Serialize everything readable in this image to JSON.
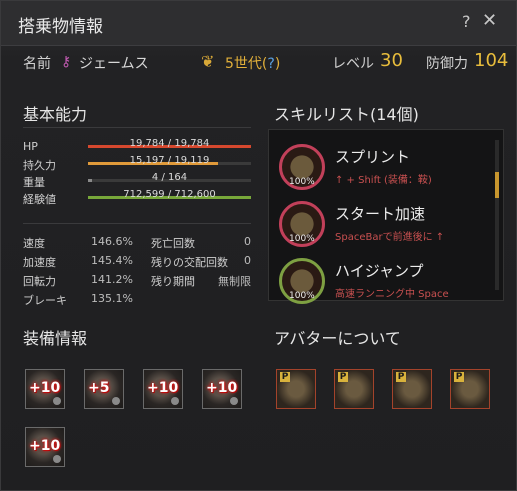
{
  "window": {
    "title": "搭乗物情報",
    "help": "?",
    "close": "✕"
  },
  "info": {
    "name_label": "名前",
    "name_value": "ジェームス",
    "generation": "5世代",
    "generation_q_open": "(",
    "generation_q": "?",
    "generation_q_close": ")",
    "level_label": "レベル",
    "level_value": "30",
    "defense_label": "防御力",
    "defense_value": "104"
  },
  "basic": {
    "title": "基本能力",
    "bars": [
      {
        "label": "HP",
        "text": "19,784 / 19,784",
        "fill": 1.0,
        "color": "#d6482e"
      },
      {
        "label": "持久力",
        "text": "15,197 / 19,119",
        "fill": 0.795,
        "color": "#e09a3a"
      },
      {
        "label": "重量",
        "text": "4 / 164",
        "fill": 0.024,
        "color": "#8a8a8a"
      },
      {
        "label": "経験値",
        "text": "712,599 / 712,600",
        "fill": 1.0,
        "color": "#78a83a"
      }
    ],
    "stats_left": [
      {
        "k": "速度",
        "v": "146.6%"
      },
      {
        "k": "加速度",
        "v": "145.4%"
      },
      {
        "k": "回転力",
        "v": "141.2%"
      },
      {
        "k": "ブレーキ",
        "v": "135.1%"
      }
    ],
    "stats_right": [
      {
        "k": "死亡回数",
        "v": "0"
      },
      {
        "k": "残りの交配回数",
        "v": "0"
      },
      {
        "k": "残り期間",
        "v": "無制限"
      }
    ]
  },
  "skills": {
    "title": "スキルリスト(14個)",
    "items": [
      {
        "name": "スプリント",
        "desc": "↑ + Shift (装備：鞍)",
        "pct": "100%",
        "icon": "sprint-skill-icon"
      },
      {
        "name": "スタート加速",
        "desc": "SpaceBarで前進後に ↑",
        "pct": "100%",
        "icon": "start-accel-skill-icon"
      },
      {
        "name": "ハイジャンプ",
        "desc": "高速ランニング中 Space",
        "pct": "100%",
        "icon": "high-jump-skill-icon"
      }
    ]
  },
  "equipment": {
    "title": "装備情報",
    "items": [
      {
        "enh": "+10",
        "icon": "horse-champron-icon"
      },
      {
        "enh": "+5",
        "icon": "horse-saddle-icon"
      },
      {
        "enh": "+10",
        "icon": "horse-stirrups-icon"
      },
      {
        "enh": "+10",
        "icon": "horse-barding-icon"
      },
      {
        "enh": "+10",
        "icon": "horseshoe-icon"
      }
    ]
  },
  "avatar": {
    "title": "アバターについて",
    "badge": "P",
    "items": [
      {
        "icon": "avatar-barding-icon"
      },
      {
        "icon": "avatar-champron-icon"
      },
      {
        "icon": "avatar-stirrups-icon"
      },
      {
        "icon": "avatar-saddle-icon"
      }
    ]
  }
}
